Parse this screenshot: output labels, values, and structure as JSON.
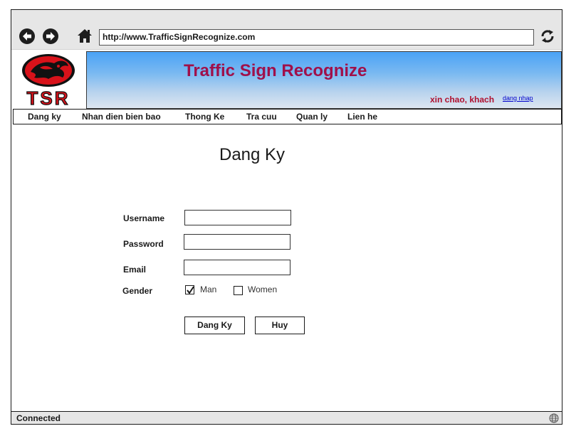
{
  "browser": {
    "url": "http://www.TrafficSignRecognize.com",
    "back_icon": "arrow-left-icon",
    "forward_icon": "arrow-right-icon",
    "home_icon": "home-icon",
    "refresh_icon": "refresh-icon",
    "status": "Connected",
    "status_icon": "globe-icon"
  },
  "header": {
    "logo_text": "TSR",
    "title": "Traffic Sign Recognize",
    "greeting": "xin chao, khach",
    "login_link": "dang nhap",
    "title_color": "#a0104a",
    "greeting_color": "#b0102e"
  },
  "menu": {
    "items": [
      {
        "label": "Dang ky"
      },
      {
        "label": "Nhan dien bien bao"
      },
      {
        "label": "Thong Ke"
      },
      {
        "label": "Tra cuu"
      },
      {
        "label": "Quan ly"
      },
      {
        "label": "Lien he"
      }
    ]
  },
  "form": {
    "title": "Dang Ky",
    "username_label": "Username",
    "username_value": "",
    "password_label": "Password",
    "password_value": "",
    "email_label": "Email",
    "email_value": "",
    "gender_label": "Gender",
    "gender_options": [
      {
        "label": "Man",
        "checked": true
      },
      {
        "label": "Women",
        "checked": false
      }
    ],
    "submit_label": "Dang Ky",
    "cancel_label": "Huy"
  }
}
